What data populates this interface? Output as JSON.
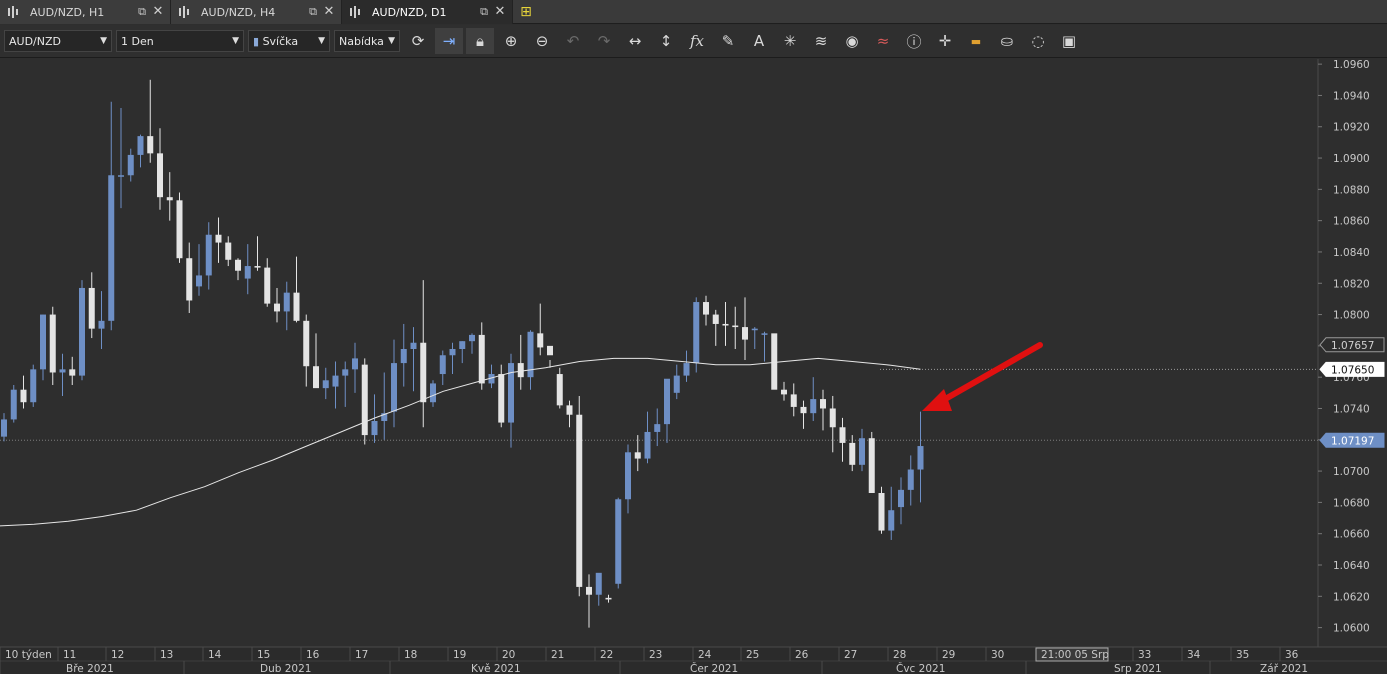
{
  "tabs": [
    {
      "label": "AUD/NZD, H1",
      "active": false
    },
    {
      "label": "AUD/NZD, H4",
      "active": false
    },
    {
      "label": "AUD/NZD, D1",
      "active": true
    }
  ],
  "toolbar": {
    "symbol": "AUD/NZD",
    "timeframe": "1 Den",
    "chart_type": "Svíčka",
    "price_type": "Nabídka",
    "icons": [
      "refresh-icon",
      "autoscroll-icon",
      "lock-icon",
      "zoom-in-icon",
      "zoom-out-icon",
      "undo-icon",
      "redo-icon",
      "horizontal-scale-icon",
      "vertical-scale-icon",
      "indicators-icon",
      "pencil-icon",
      "text-icon",
      "crosshair-icon",
      "layers-icon",
      "eye-icon",
      "signals-icon",
      "info-icon",
      "cursor-icon",
      "color-scheme-icon",
      "fill-icon",
      "template-icon",
      "save-icon"
    ]
  },
  "chart_data": {
    "type": "candlestick",
    "symbol": "AUD/NZD",
    "timeframe": "D1",
    "y_ticks": [
      "1.0960",
      "1.0940",
      "1.0920",
      "1.0900",
      "1.0880",
      "1.0860",
      "1.0840",
      "1.0820",
      "1.0800",
      "1.0780",
      "1.0760",
      "1.0740",
      "1.0720",
      "1.0700",
      "1.0680",
      "1.0660",
      "1.0640",
      "1.0620",
      "1.0600"
    ],
    "ylim": [
      1.0594,
      1.0962
    ],
    "price_labels": [
      {
        "text": "1.07657",
        "value": 1.07807,
        "style": "dark"
      },
      {
        "text": "1.07650",
        "value": 1.0765,
        "style": "white"
      },
      {
        "text": "1.07197",
        "value": 1.07197,
        "style": "blue"
      }
    ],
    "week_labels": [
      "10 týden",
      "11",
      "12",
      "13",
      "14",
      "15",
      "16",
      "17",
      "18",
      "19",
      "20",
      "21",
      "22",
      "23",
      "24",
      "25",
      "26",
      "27",
      "28",
      "29",
      "30",
      "21:00 05 Srp",
      "33",
      "34",
      "35",
      "36"
    ],
    "month_labels": [
      "Bře 2021",
      "Dub 2021",
      "Kvě 2021",
      "Čer 2021",
      "Čvc 2021",
      "Srp 2021",
      "Zář 2021"
    ],
    "bull_color": "#6e8fc5",
    "bear_color": "#e4e4e4",
    "ma_color": "#e6e6e6",
    "arrow_color": "#e01010",
    "candles": [
      [
        1.0722,
        1.0737,
        1.0719,
        1.0733
      ],
      [
        1.0733,
        1.0755,
        1.0731,
        1.0752
      ],
      [
        1.0752,
        1.0761,
        1.074,
        1.0744
      ],
      [
        1.0744,
        1.0768,
        1.0741,
        1.0765
      ],
      [
        1.0765,
        1.08,
        1.0758,
        1.08
      ],
      [
        1.08,
        1.0805,
        1.0755,
        1.0763
      ],
      [
        1.0763,
        1.0775,
        1.0748,
        1.0765
      ],
      [
        1.0765,
        1.0773,
        1.0755,
        1.0761
      ],
      [
        1.0761,
        1.0822,
        1.0758,
        1.0817
      ],
      [
        1.0817,
        1.0827,
        1.0785,
        1.0791
      ],
      [
        1.0791,
        1.0815,
        1.0778,
        1.0796
      ],
      [
        1.0796,
        1.0936,
        1.079,
        1.0889
      ],
      [
        1.0889,
        1.0932,
        1.0868,
        1.0889
      ],
      [
        1.0889,
        1.0906,
        1.0885,
        1.0902
      ],
      [
        1.0902,
        1.0915,
        1.0894,
        1.0914
      ],
      [
        1.0914,
        1.095,
        1.0897,
        1.0903
      ],
      [
        1.0903,
        1.0919,
        1.0867,
        1.0875
      ],
      [
        1.0875,
        1.0891,
        1.086,
        1.0873
      ],
      [
        1.0873,
        1.0878,
        1.0833,
        1.0836
      ],
      [
        1.0836,
        1.0846,
        1.0801,
        1.0809
      ],
      [
        1.0818,
        1.0845,
        1.0812,
        1.0825
      ],
      [
        1.0825,
        1.0859,
        1.0816,
        1.0851
      ],
      [
        1.0851,
        1.0862,
        1.0833,
        1.0846
      ],
      [
        1.0846,
        1.085,
        1.0831,
        1.0835
      ],
      [
        1.0835,
        1.0836,
        1.0822,
        1.0828
      ],
      [
        1.0823,
        1.0845,
        1.0813,
        1.0831
      ],
      [
        1.0831,
        1.085,
        1.0828,
        1.083
      ],
      [
        1.083,
        1.0836,
        1.0805,
        1.0807
      ],
      [
        1.0807,
        1.0817,
        1.0795,
        1.0802
      ],
      [
        1.0802,
        1.0821,
        1.079,
        1.0814
      ],
      [
        1.0814,
        1.0837,
        1.0795,
        1.0796
      ],
      [
        1.0796,
        1.08,
        1.0754,
        1.0767
      ],
      [
        1.0767,
        1.0788,
        1.0758,
        1.0753
      ],
      [
        1.0753,
        1.0766,
        1.0746,
        1.0758
      ],
      [
        1.0754,
        1.077,
        1.074,
        1.0761
      ],
      [
        1.0761,
        1.077,
        1.0741,
        1.0765
      ],
      [
        1.0765,
        1.0782,
        1.075,
        1.0772
      ],
      [
        1.0768,
        1.0772,
        1.0717,
        1.0723
      ],
      [
        1.0723,
        1.0749,
        1.0718,
        1.0732
      ],
      [
        1.0732,
        1.0763,
        1.072,
        1.0737
      ],
      [
        1.0738,
        1.0784,
        1.0728,
        1.0769
      ],
      [
        1.0769,
        1.0794,
        1.0754,
        1.0778
      ],
      [
        1.0778,
        1.0792,
        1.0751,
        1.0782
      ],
      [
        1.0782,
        1.0822,
        1.0728,
        1.0744
      ],
      [
        1.0744,
        1.0758,
        1.0741,
        1.0756
      ],
      [
        1.0762,
        1.0777,
        1.0755,
        1.0774
      ],
      [
        1.0774,
        1.0782,
        1.0762,
        1.0778
      ],
      [
        1.0778,
        1.0783,
        1.0769,
        1.0783
      ],
      [
        1.0783,
        1.0788,
        1.0775,
        1.0787
      ],
      [
        1.0787,
        1.0795,
        1.0752,
        1.0756
      ],
      [
        1.0756,
        1.0768,
        1.0753,
        1.0762
      ],
      [
        1.0762,
        1.0768,
        1.0728,
        1.0731
      ],
      [
        1.0731,
        1.0775,
        1.0715,
        1.0769
      ],
      [
        1.0769,
        1.0787,
        1.0752,
        1.076
      ],
      [
        1.076,
        1.079,
        1.0752,
        1.0789
      ],
      [
        1.0788,
        1.0807,
        1.0774,
        1.0779
      ],
      [
        1.078,
        1.0771,
        1.0766,
        1.0774
      ],
      [
        1.0762,
        1.0766,
        1.074,
        1.0742
      ],
      [
        1.0742,
        1.0745,
        1.0728,
        1.0736
      ],
      [
        1.0736,
        1.0748,
        1.062,
        1.0626
      ],
      [
        1.0626,
        1.0634,
        1.06,
        1.0621
      ],
      [
        1.0621,
        1.0634,
        1.0614,
        1.0635
      ],
      [
        1.0619,
        1.0621,
        1.0616,
        1.0618
      ],
      [
        1.0628,
        1.0683,
        1.0625,
        1.0682
      ],
      [
        1.0682,
        1.0717,
        1.0673,
        1.0712
      ],
      [
        1.0712,
        1.0723,
        1.07,
        1.0708
      ],
      [
        1.0708,
        1.0738,
        1.0705,
        1.0725
      ],
      [
        1.0725,
        1.074,
        1.0716,
        1.073
      ],
      [
        1.073,
        1.0754,
        1.0718,
        1.0759
      ],
      [
        1.075,
        1.0768,
        1.0746,
        1.0761
      ],
      [
        1.0761,
        1.0777,
        1.0757,
        1.0769
      ],
      [
        1.0769,
        1.0811,
        1.0763,
        1.0808
      ],
      [
        1.0808,
        1.0812,
        1.0793,
        1.08
      ],
      [
        1.08,
        1.0803,
        1.078,
        1.0794
      ],
      [
        1.0794,
        1.0808,
        1.078,
        1.0793
      ],
      [
        1.0793,
        1.0805,
        1.0778,
        1.0792
      ],
      [
        1.0792,
        1.0811,
        1.0771,
        1.0784
      ],
      [
        1.079,
        1.0792,
        1.0778,
        1.0791
      ],
      [
        1.0788,
        1.0789,
        1.077,
        1.0788
      ],
      [
        1.0788,
        1.0762,
        1.0755,
        1.0752
      ],
      [
        1.0752,
        1.0757,
        1.0745,
        1.0749
      ],
      [
        1.0749,
        1.0756,
        1.0735,
        1.0741
      ],
      [
        1.0741,
        1.0745,
        1.0727,
        1.0737
      ],
      [
        1.0737,
        1.076,
        1.0732,
        1.0746
      ],
      [
        1.0746,
        1.0752,
        1.0726,
        1.074
      ],
      [
        1.074,
        1.0748,
        1.0712,
        1.0728
      ],
      [
        1.0728,
        1.0734,
        1.0706,
        1.0718
      ],
      [
        1.0718,
        1.0723,
        1.07,
        1.0704
      ],
      [
        1.0704,
        1.0727,
        1.07,
        1.0721
      ],
      [
        1.0721,
        1.0725,
        1.0705,
        1.0686
      ],
      [
        1.0686,
        1.069,
        1.066,
        1.0662
      ],
      [
        1.0662,
        1.069,
        1.0656,
        1.0675
      ],
      [
        1.0677,
        1.0696,
        1.0666,
        1.0688
      ],
      [
        1.0688,
        1.071,
        1.0678,
        1.0701
      ],
      [
        1.0701,
        1.0738,
        1.068,
        1.0716
      ]
    ],
    "ma": [
      1.0665,
      1.0666,
      1.0668,
      1.0671,
      1.0675,
      1.0683,
      1.069,
      1.0699,
      1.0707,
      1.0716,
      1.0725,
      1.0734,
      1.0742,
      1.0751,
      1.0757,
      1.0763,
      1.0766,
      1.077,
      1.0772,
      1.0772,
      1.077,
      1.0768,
      1.0768,
      1.077,
      1.0772,
      1.077,
      1.0768,
      1.0765
    ]
  }
}
